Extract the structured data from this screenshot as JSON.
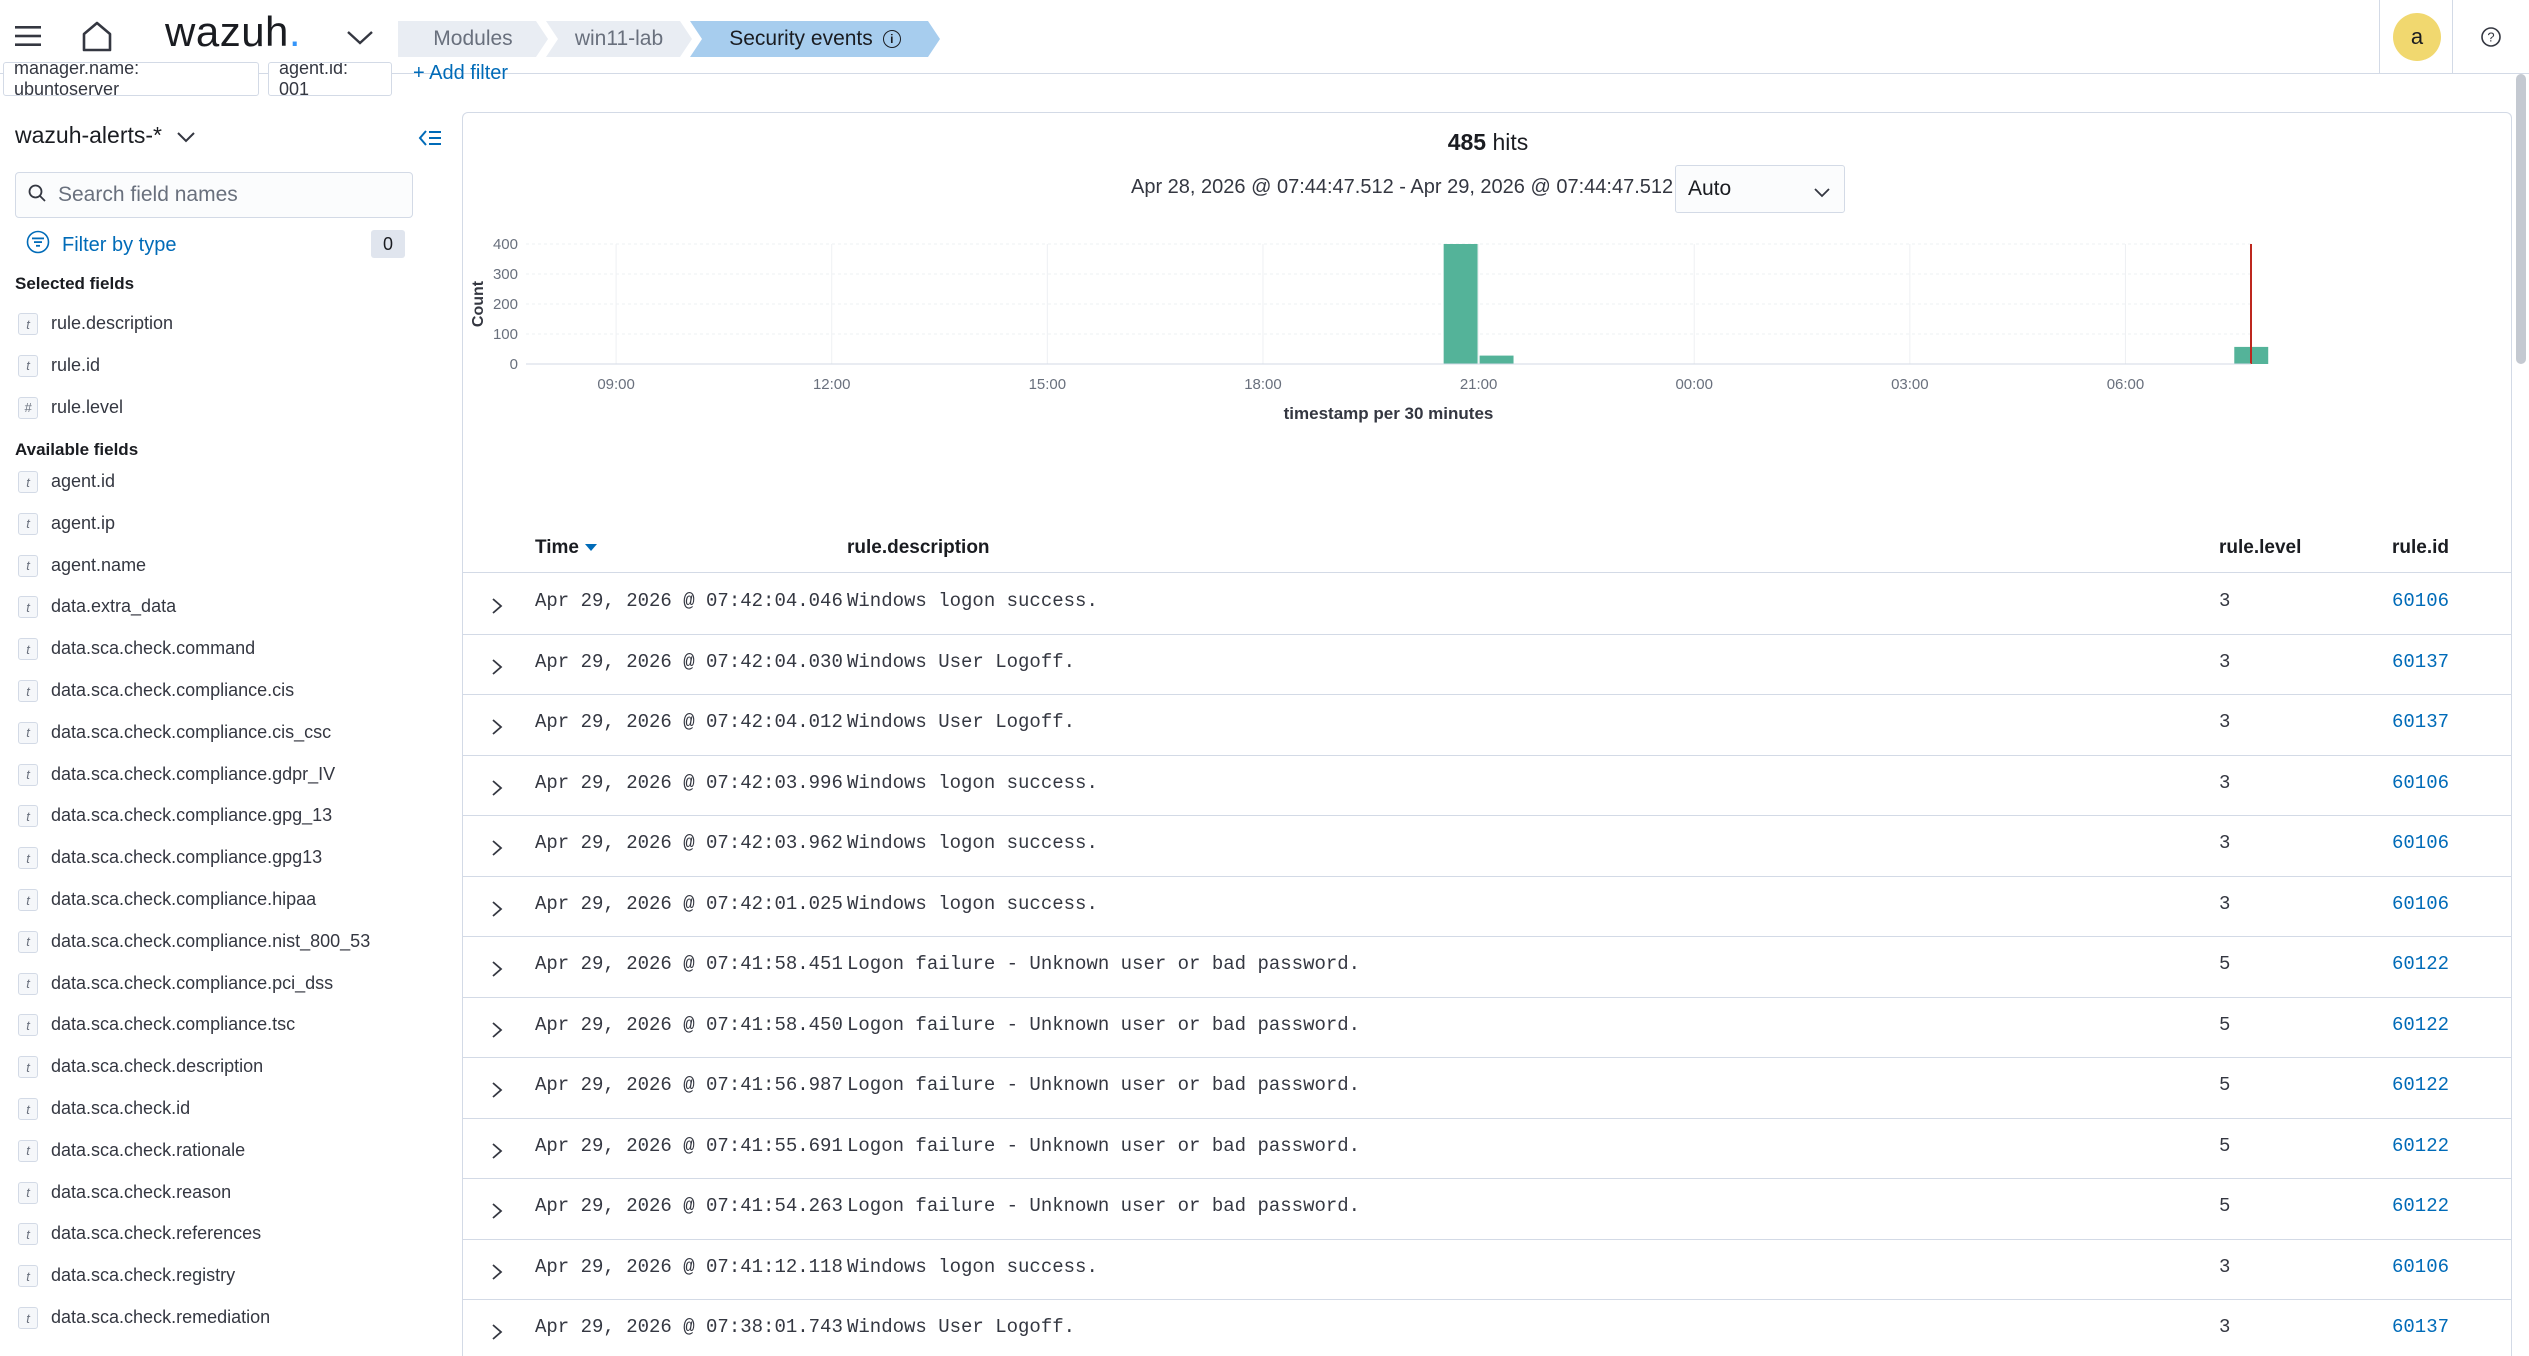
{
  "header": {
    "logo_text": "wazuh",
    "logo_dot": ".",
    "breadcrumbs": [
      "Modules",
      "win11-lab",
      "Security events"
    ],
    "avatar_letter": "a",
    "info_glyph": "i",
    "help_glyph": "?"
  },
  "filters": {
    "pills": [
      "manager.name: ubuntoserver",
      "agent.id: 001"
    ],
    "add_label": "+ Add filter"
  },
  "sidebar": {
    "index_pattern": "wazuh-alerts-*",
    "search_placeholder": "Search field names",
    "filter_by_type_label": "Filter by type",
    "filter_count": "0",
    "selected_title": "Selected fields",
    "available_title": "Available fields",
    "selected_fields": [
      {
        "name": "rule.description",
        "type": "t"
      },
      {
        "name": "rule.id",
        "type": "t"
      },
      {
        "name": "rule.level",
        "type": "#"
      }
    ],
    "available_fields": [
      {
        "name": "agent.id",
        "type": "t"
      },
      {
        "name": "agent.ip",
        "type": "t"
      },
      {
        "name": "agent.name",
        "type": "t"
      },
      {
        "name": "data.extra_data",
        "type": "t"
      },
      {
        "name": "data.sca.check.command",
        "type": "t"
      },
      {
        "name": "data.sca.check.compliance.cis",
        "type": "t"
      },
      {
        "name": "data.sca.check.compliance.cis_csc",
        "type": "t"
      },
      {
        "name": "data.sca.check.compliance.gdpr_IV",
        "type": "t"
      },
      {
        "name": "data.sca.check.compliance.gpg_13",
        "type": "t"
      },
      {
        "name": "data.sca.check.compliance.gpg13",
        "type": "t"
      },
      {
        "name": "data.sca.check.compliance.hipaa",
        "type": "t"
      },
      {
        "name": "data.sca.check.compliance.nist_800_53",
        "type": "t"
      },
      {
        "name": "data.sca.check.compliance.pci_dss",
        "type": "t"
      },
      {
        "name": "data.sca.check.compliance.tsc",
        "type": "t"
      },
      {
        "name": "data.sca.check.description",
        "type": "t"
      },
      {
        "name": "data.sca.check.id",
        "type": "t"
      },
      {
        "name": "data.sca.check.rationale",
        "type": "t"
      },
      {
        "name": "data.sca.check.reason",
        "type": "t"
      },
      {
        "name": "data.sca.check.references",
        "type": "t"
      },
      {
        "name": "data.sca.check.registry",
        "type": "t"
      },
      {
        "name": "data.sca.check.remediation",
        "type": "t"
      }
    ]
  },
  "summary": {
    "hits_count": "485",
    "hits_label": "hits",
    "time_range": "Apr 28, 2026 @ 07:44:47.512 - Apr 29, 2026 @ 07:44:47.512",
    "interval": "Auto"
  },
  "chart_data": {
    "type": "bar",
    "ylabel": "Count",
    "xlabel": "timestamp per 30 minutes",
    "ylim": [
      0,
      400
    ],
    "yticks": [
      0,
      100,
      200,
      300,
      400
    ],
    "xticks": [
      "09:00",
      "12:00",
      "15:00",
      "18:00",
      "21:00",
      "00:00",
      "03:00",
      "06:00"
    ],
    "bars": [
      {
        "time": "Apr 28, 2026 @ 20:30",
        "count": 400
      },
      {
        "time": "Apr 28, 2026 @ 21:00",
        "count": 28
      },
      {
        "time": "Apr 29, 2026 @ 07:30",
        "count": 57
      }
    ],
    "now_marker": "Apr 29, 2026 @ 07:44:47.512",
    "bar_color": "#54b399",
    "marker_color": "#bd271e"
  },
  "table": {
    "columns": {
      "time": "Time",
      "description": "rule.description",
      "level": "rule.level",
      "id": "rule.id"
    },
    "rows": [
      {
        "time": "Apr 29, 2026 @ 07:42:04.046",
        "description": "Windows logon success.",
        "level": "3",
        "id": "60106"
      },
      {
        "time": "Apr 29, 2026 @ 07:42:04.030",
        "description": "Windows User Logoff.",
        "level": "3",
        "id": "60137"
      },
      {
        "time": "Apr 29, 2026 @ 07:42:04.012",
        "description": "Windows User Logoff.",
        "level": "3",
        "id": "60137"
      },
      {
        "time": "Apr 29, 2026 @ 07:42:03.996",
        "description": "Windows logon success.",
        "level": "3",
        "id": "60106"
      },
      {
        "time": "Apr 29, 2026 @ 07:42:03.962",
        "description": "Windows logon success.",
        "level": "3",
        "id": "60106"
      },
      {
        "time": "Apr 29, 2026 @ 07:42:01.025",
        "description": "Windows logon success.",
        "level": "3",
        "id": "60106"
      },
      {
        "time": "Apr 29, 2026 @ 07:41:58.451",
        "description": "Logon failure - Unknown user or bad password.",
        "level": "5",
        "id": "60122"
      },
      {
        "time": "Apr 29, 2026 @ 07:41:58.450",
        "description": "Logon failure - Unknown user or bad password.",
        "level": "5",
        "id": "60122"
      },
      {
        "time": "Apr 29, 2026 @ 07:41:56.987",
        "description": "Logon failure - Unknown user or bad password.",
        "level": "5",
        "id": "60122"
      },
      {
        "time": "Apr 29, 2026 @ 07:41:55.691",
        "description": "Logon failure - Unknown user or bad password.",
        "level": "5",
        "id": "60122"
      },
      {
        "time": "Apr 29, 2026 @ 07:41:54.263",
        "description": "Logon failure - Unknown user or bad password.",
        "level": "5",
        "id": "60122"
      },
      {
        "time": "Apr 29, 2026 @ 07:41:12.118",
        "description": "Windows logon success.",
        "level": "3",
        "id": "60106"
      },
      {
        "time": "Apr 29, 2026 @ 07:38:01.743",
        "description": "Windows User Logoff.",
        "level": "3",
        "id": "60137"
      }
    ]
  },
  "colors": {
    "accent": "#006bb8",
    "breadcrumb_active": "#a7cdee",
    "avatar": "#f1d86f"
  }
}
